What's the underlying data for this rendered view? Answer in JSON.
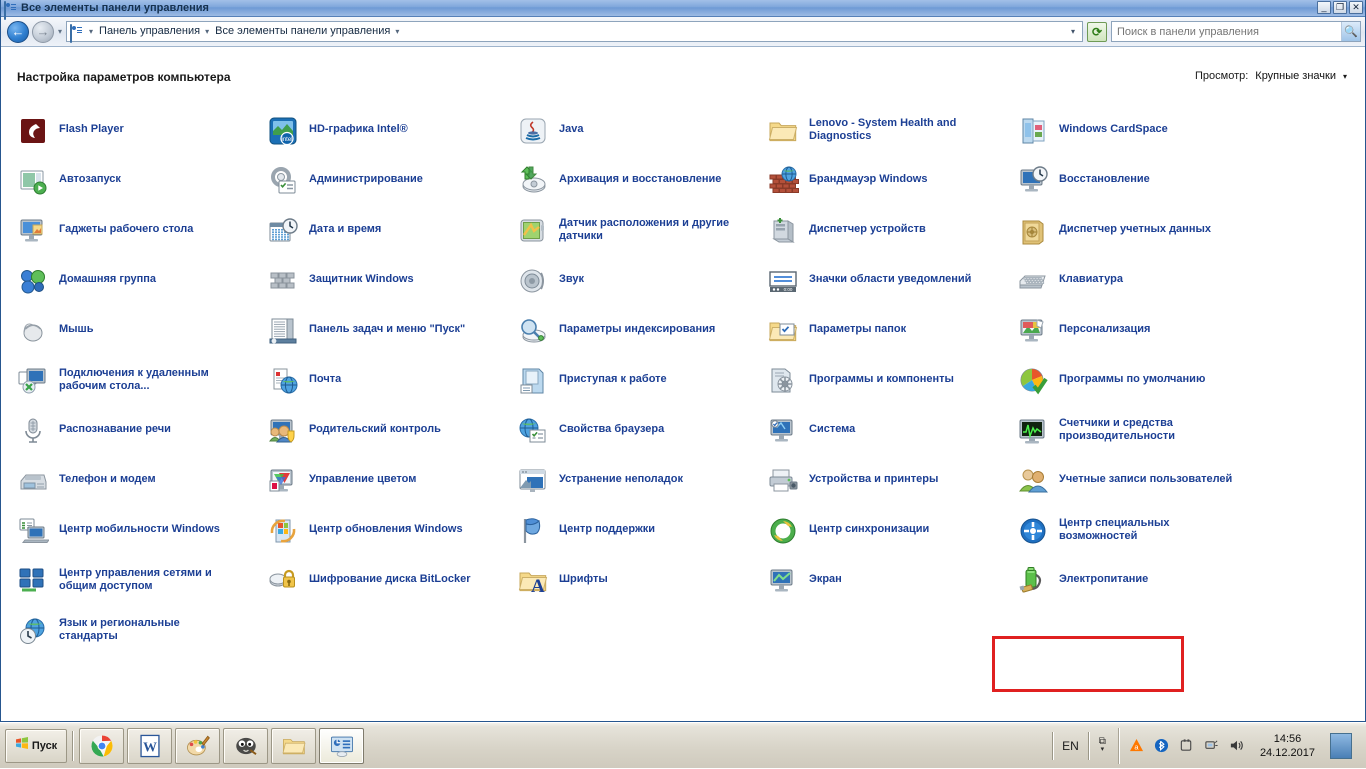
{
  "window": {
    "title": "Все элементы панели управления",
    "title_icon": "control-panel-icon",
    "buttons": {
      "minimize": "_",
      "restore": "❐",
      "close": "✕"
    }
  },
  "navbar": {
    "back_icon": "back-arrow-icon",
    "forward_icon": "forward-arrow-icon",
    "recent_icon": "recent-pages-caret-icon",
    "address_icon": "control-panel-icon",
    "breadcrumbs": [
      "Панель управления",
      "Все элементы панели управления"
    ],
    "separator": "▸",
    "dropdown_icon": "address-dropdown-caret",
    "refresh_icon": "refresh-icon",
    "search": {
      "placeholder": "Поиск в панели управления",
      "value": "",
      "icon": "search-icon"
    }
  },
  "header": {
    "page_title": "Настройка параметров компьютера",
    "view_label": "Просмотр:",
    "view_value": "Крупные значки",
    "view_caret": "▾"
  },
  "highlight": {
    "color": "#e02020",
    "target": "Электропитание"
  },
  "columns": [
    [
      {
        "label": "Flash Player",
        "icon": "flash-player-icon",
        "lines": 1
      },
      {
        "label": "Автозапуск",
        "icon": "autoplay-icon",
        "lines": 1
      },
      {
        "label": "Гаджеты рабочего стола",
        "icon": "desktop-gadgets-icon",
        "lines": 1
      },
      {
        "label": "Домашняя группа",
        "icon": "homegroup-icon",
        "lines": 1
      },
      {
        "label": "Мышь",
        "icon": "mouse-icon",
        "lines": 1
      },
      {
        "label": "Подключения к удаленным рабочим стола...",
        "icon": "remote-desktop-icon",
        "lines": 2
      },
      {
        "label": "Распознавание речи",
        "icon": "speech-recognition-icon",
        "lines": 1
      },
      {
        "label": "Телефон и модем",
        "icon": "phone-modem-icon",
        "lines": 1
      },
      {
        "label": "Центр мобильности Windows",
        "icon": "mobility-center-icon",
        "lines": 1
      },
      {
        "label": "Центр управления сетями и общим доступом",
        "icon": "network-sharing-center-icon",
        "lines": 2
      },
      {
        "label": "Язык и региональные стандарты",
        "icon": "region-language-icon",
        "lines": 2
      }
    ],
    [
      {
        "label": "HD-графика Intel®",
        "icon": "intel-hd-graphics-icon",
        "lines": 1
      },
      {
        "label": "Администрирование",
        "icon": "administrative-tools-icon",
        "lines": 1
      },
      {
        "label": "Дата и время",
        "icon": "date-time-icon",
        "lines": 1
      },
      {
        "label": "Защитник Windows",
        "icon": "windows-defender-icon",
        "lines": 1
      },
      {
        "label": "Панель задач и меню \"Пуск\"",
        "icon": "taskbar-startmenu-icon",
        "lines": 1
      },
      {
        "label": "Почта",
        "icon": "mail-icon",
        "lines": 1
      },
      {
        "label": "Родительский контроль",
        "icon": "parental-controls-icon",
        "lines": 1
      },
      {
        "label": "Управление цветом",
        "icon": "color-management-icon",
        "lines": 1
      },
      {
        "label": "Центр обновления Windows",
        "icon": "windows-update-icon",
        "lines": 1
      },
      {
        "label": "Шифрование диска BitLocker",
        "icon": "bitlocker-icon",
        "lines": 1
      }
    ],
    [
      {
        "label": "Java",
        "icon": "java-icon",
        "lines": 1
      },
      {
        "label": "Архивация и восстановление",
        "icon": "backup-restore-icon",
        "lines": 1
      },
      {
        "label": "Датчик расположения и другие датчики",
        "icon": "location-sensors-icon",
        "lines": 2
      },
      {
        "label": "Звук",
        "icon": "sound-icon",
        "lines": 1
      },
      {
        "label": "Параметры индексирования",
        "icon": "indexing-options-icon",
        "lines": 1
      },
      {
        "label": "Приступая к работе",
        "icon": "getting-started-icon",
        "lines": 1
      },
      {
        "label": "Свойства браузера",
        "icon": "internet-options-icon",
        "lines": 1
      },
      {
        "label": "Устранение неполадок",
        "icon": "troubleshooting-icon",
        "lines": 1
      },
      {
        "label": "Центр поддержки",
        "icon": "action-center-icon",
        "lines": 1
      },
      {
        "label": "Шрифты",
        "icon": "fonts-icon",
        "lines": 1
      }
    ],
    [
      {
        "label": "Lenovo - System Health and Diagnostics",
        "icon": "folder-icon",
        "lines": 2
      },
      {
        "label": "Брандмауэр Windows",
        "icon": "windows-firewall-icon",
        "lines": 1
      },
      {
        "label": "Диспетчер устройств",
        "icon": "device-manager-icon",
        "lines": 1
      },
      {
        "label": "Значки области уведомлений",
        "icon": "notification-area-icons-icon",
        "lines": 1
      },
      {
        "label": "Параметры папок",
        "icon": "folder-options-icon",
        "lines": 1
      },
      {
        "label": "Программы и компоненты",
        "icon": "programs-features-icon",
        "lines": 1
      },
      {
        "label": "Система",
        "icon": "system-icon",
        "lines": 1
      },
      {
        "label": "Устройства и принтеры",
        "icon": "devices-printers-icon",
        "lines": 1
      },
      {
        "label": "Центр синхронизации",
        "icon": "sync-center-icon",
        "lines": 1
      },
      {
        "label": "Экран",
        "icon": "display-icon",
        "lines": 1
      }
    ],
    [
      {
        "label": "Windows CardSpace",
        "icon": "cardspace-icon",
        "lines": 1
      },
      {
        "label": "Восстановление",
        "icon": "recovery-icon",
        "lines": 1
      },
      {
        "label": "Диспетчер учетных данных",
        "icon": "credential-manager-icon",
        "lines": 1
      },
      {
        "label": "Клавиатура",
        "icon": "keyboard-icon",
        "lines": 1
      },
      {
        "label": "Персонализация",
        "icon": "personalization-icon",
        "lines": 1
      },
      {
        "label": "Программы по умолчанию",
        "icon": "default-programs-icon",
        "lines": 1
      },
      {
        "label": "Счетчики и средства производительности",
        "icon": "performance-tools-icon",
        "lines": 2
      },
      {
        "label": "Учетные записи пользователей",
        "icon": "user-accounts-icon",
        "lines": 1
      },
      {
        "label": "Центр специальных возможностей",
        "icon": "ease-of-access-icon",
        "lines": 2
      },
      {
        "label": "Электропитание",
        "icon": "power-options-icon",
        "lines": 1
      }
    ]
  ],
  "taskbar": {
    "start_label": "Пуск",
    "start_icon": "windows-logo-icon",
    "tasks": [
      {
        "name": "chrome-taskbar-button",
        "icon": "chrome-icon",
        "active": false
      },
      {
        "name": "word-taskbar-button",
        "icon": "word-icon",
        "active": false
      },
      {
        "name": "paint-taskbar-button",
        "icon": "paint-icon",
        "active": false
      },
      {
        "name": "gimp-taskbar-button",
        "icon": "gimp-icon",
        "active": false
      },
      {
        "name": "explorer-taskbar-button",
        "icon": "folder-icon",
        "active": false
      },
      {
        "name": "control-panel-taskbar-button",
        "icon": "control-panel-icon",
        "active": true
      }
    ],
    "language": "EN",
    "language_indicator_icon": "input-indicator-icon",
    "tray_icons": [
      "avast-icon",
      "bluetooth-icon",
      "safely-remove-hardware-icon",
      "network-icon",
      "volume-icon"
    ],
    "clock_time": "14:56",
    "clock_date": "24.12.2017",
    "show_desktop_icon": "show-desktop-icon"
  }
}
